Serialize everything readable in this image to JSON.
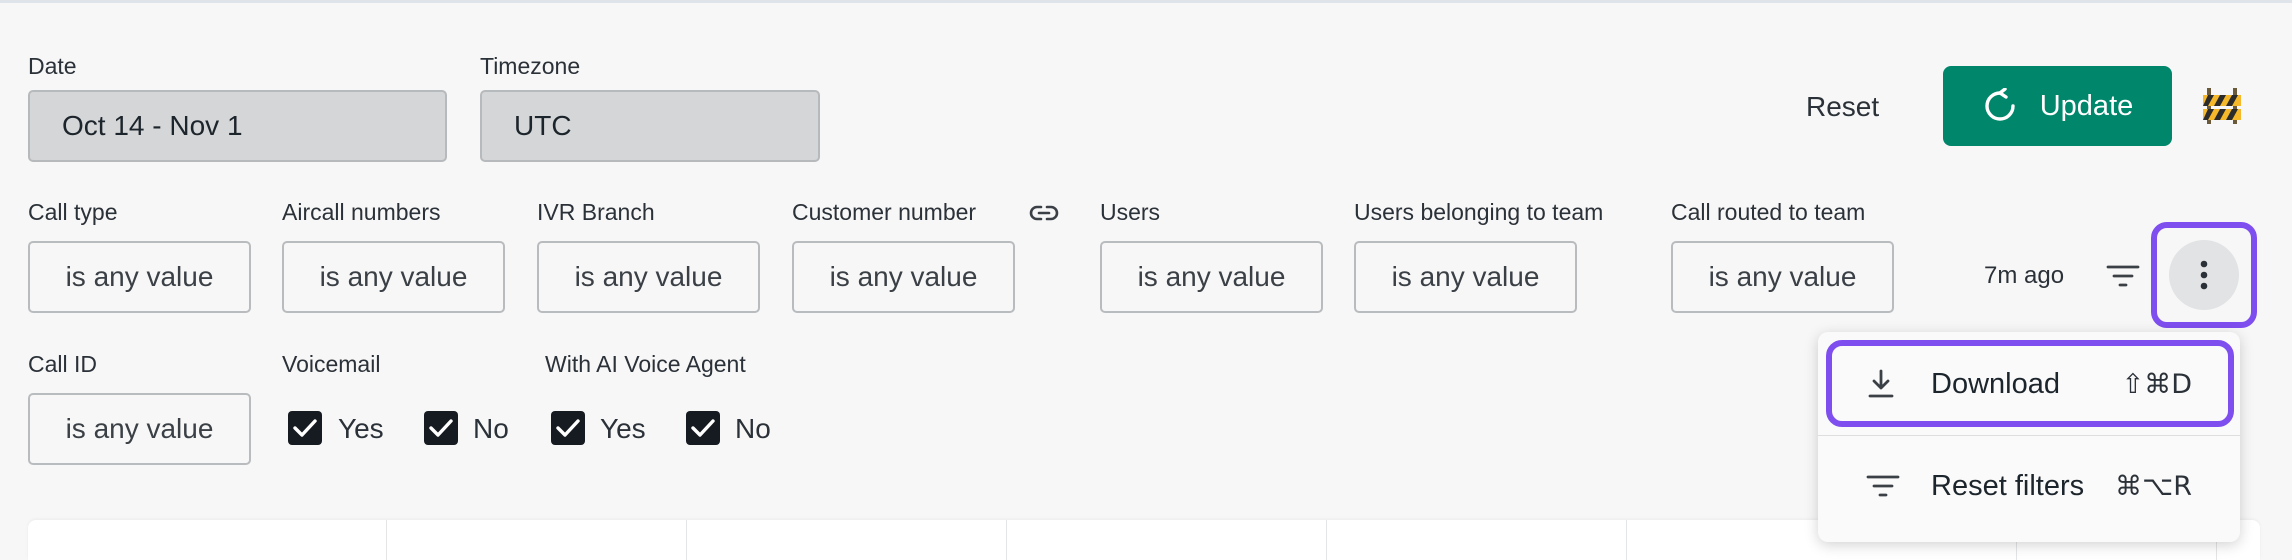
{
  "filters_top": {
    "date": {
      "label": "Date",
      "value": "Oct 14 - Nov 1"
    },
    "timezone": {
      "label": "Timezone",
      "value": "UTC"
    }
  },
  "actions": {
    "reset_label": "Reset",
    "update_label": "Update",
    "accent_color": "#00866b"
  },
  "filters": [
    {
      "label": "Call type",
      "value": "is any value"
    },
    {
      "label": "Aircall numbers",
      "value": "is any value"
    },
    {
      "label": "IVR Branch",
      "value": "is any value"
    },
    {
      "label": "Customer number",
      "value": "is any value"
    },
    {
      "label": "Users",
      "value": "is any value"
    },
    {
      "label": "Users belonging to team",
      "value": "is any value"
    },
    {
      "label": "Call routed to team",
      "value": "is any value"
    }
  ],
  "call_id": {
    "label": "Call ID",
    "value": "is any value"
  },
  "voicemail": {
    "label": "Voicemail",
    "options": [
      {
        "label": "Yes",
        "checked": true
      },
      {
        "label": "No",
        "checked": true
      }
    ]
  },
  "ai_voice_agent": {
    "label": "With AI Voice Agent",
    "options": [
      {
        "label": "Yes",
        "checked": true
      },
      {
        "label": "No",
        "checked": true
      }
    ]
  },
  "last_updated": "7m ago",
  "menu": {
    "items": [
      {
        "label": "Download",
        "shortcut": "⇧⌘D",
        "icon": "download-icon"
      },
      {
        "label": "Reset filters",
        "shortcut": "⌘⌥R",
        "icon": "filter-icon"
      }
    ]
  },
  "highlight_color": "#7f4eef"
}
